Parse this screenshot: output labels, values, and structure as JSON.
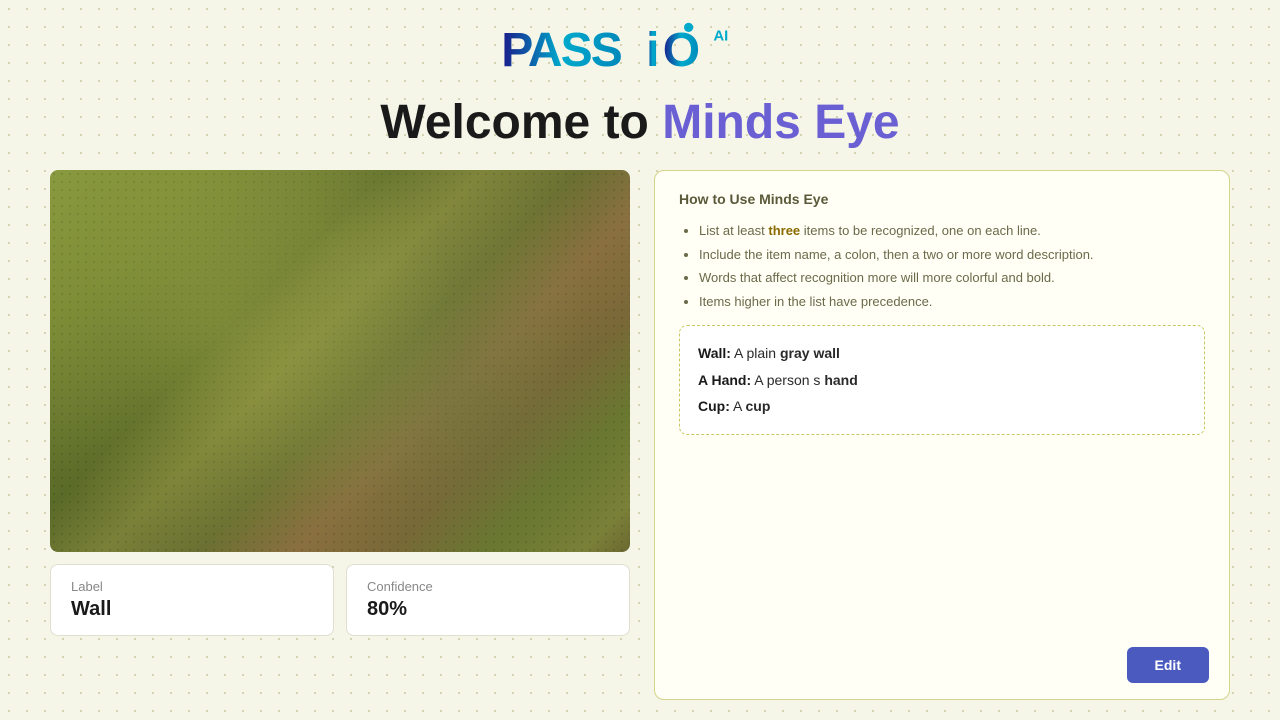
{
  "logo": {
    "alt": "Passio AI Logo"
  },
  "headline": {
    "prefix": "Welcome to ",
    "accent": "Minds Eye"
  },
  "video": {
    "aria_label": "Camera feed showing wall"
  },
  "label_card": {
    "label": "Label",
    "value": "Wall"
  },
  "confidence_card": {
    "label": "Confidence",
    "value": "80%"
  },
  "instructions": {
    "title": "How to Use Minds Eye",
    "items": [
      {
        "text_parts": [
          {
            "text": "List at least ",
            "style": "normal"
          },
          {
            "text": "three",
            "style": "highlight"
          },
          {
            "text": " items to be recognized, one on each line.",
            "style": "normal"
          }
        ]
      },
      {
        "text_parts": [
          {
            "text": "Include the item name, a colon, then a two or more word description.",
            "style": "normal"
          }
        ]
      },
      {
        "text_parts": [
          {
            "text": "Words that affect recognition more will more colorful and bold.",
            "style": "normal"
          }
        ]
      },
      {
        "text_parts": [
          {
            "text": "Items higher in the list have precedence.",
            "style": "normal"
          }
        ]
      }
    ]
  },
  "items_list": [
    {
      "name": "Wall:",
      "text": " A plain ",
      "bold_word": "gray wall"
    },
    {
      "name": "A Hand:",
      "text": " A person s ",
      "bold_word": "hand"
    },
    {
      "name": "Cup:",
      "text": " A ",
      "bold_word": "cup"
    }
  ],
  "edit_button": {
    "label": "Edit"
  }
}
